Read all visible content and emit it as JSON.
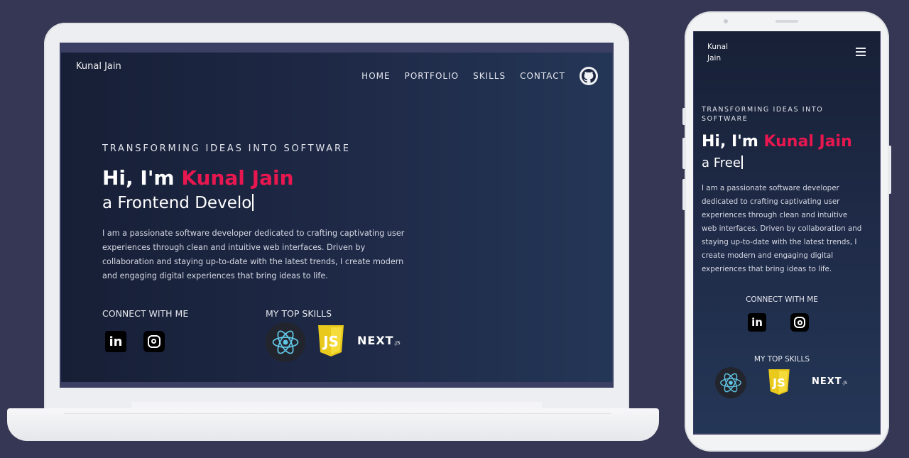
{
  "laptop": {
    "brand": "Kunal Jain",
    "nav": [
      "HOME",
      "PORTFOLIO",
      "SKILLS",
      "CONTACT"
    ],
    "tagline": "TRANSFORMING IDEAS INTO SOFTWARE",
    "greeting": "Hi, I'm ",
    "name": "Kunal Jain",
    "typed": "a Frontend Develo",
    "description": "I am a passionate software developer dedicated to crafting captivating user experiences through clean and intuitive web interfaces. Driven by collaboration and staying up-to-date with the latest trends, I create modern and engaging digital experiences that bring ideas to life.",
    "connect_heading": "CONNECT WITH ME",
    "skills_heading": "MY TOP SKILLS",
    "linkedin_text": "in",
    "next_logo": "NEXT",
    "next_suffix": ".JS",
    "js_logo": "JS"
  },
  "phone": {
    "brand": "Kunal Jain",
    "tagline": "TRANSFORMING IDEAS INTO SOFTWARE",
    "greeting": "Hi, I'm ",
    "name": "Kunal Jain",
    "typed": "a Free",
    "description": "I am a passionate software developer dedicated to crafting captivating user experiences through clean and intuitive web interfaces. Driven by collaboration and staying up-to-date with the latest trends, I create modern and engaging digital experiences that bring ideas to life.",
    "connect_heading": "CONNECT WITH ME",
    "skills_heading": "MY TOP SKILLS",
    "linkedin_text": "in",
    "next_logo": "NEXT",
    "next_suffix": ".JS",
    "js_logo": "JS"
  },
  "colors": {
    "accent": "#e8174f",
    "background": "#363754",
    "site_bg": "#1f2a48",
    "js_yellow": "#f0d41f",
    "react_blue": "#61c6e6"
  },
  "icons": [
    "github-icon",
    "linkedin-icon",
    "instagram-icon",
    "react-icon",
    "javascript-icon",
    "nextjs-icon",
    "hamburger-menu-icon"
  ]
}
